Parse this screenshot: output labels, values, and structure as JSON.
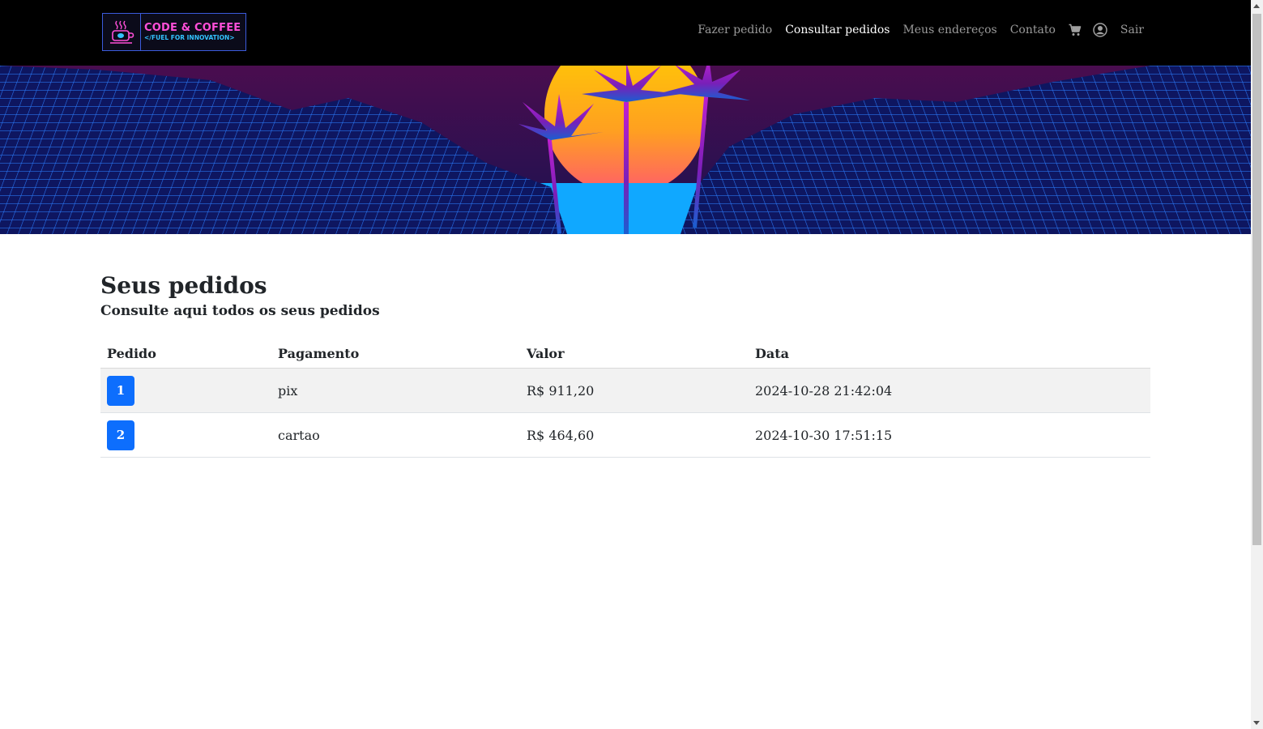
{
  "brand": {
    "title": "CODE & COFFEE",
    "subtitle": "</FUEL FOR INNOVATION>"
  },
  "nav": {
    "items": [
      {
        "label": "Fazer pedido",
        "active": false
      },
      {
        "label": "Consultar pedidos",
        "active": true
      },
      {
        "label": "Meus endereços",
        "active": false
      },
      {
        "label": "Contato",
        "active": false
      }
    ],
    "cart_icon": "cart-icon",
    "account_icon": "user-circle-icon",
    "logout_label": "Sair"
  },
  "colors": {
    "accent": "#0d6efd",
    "navbar_bg": "#000000",
    "banner_sun": "#ffb000",
    "banner_grid": "#1e6bff"
  },
  "main": {
    "title": "Seus pedidos",
    "subtitle": "Consulte aqui todos os seus pedidos",
    "table": {
      "headers": [
        "Pedido",
        "Pagamento",
        "Valor",
        "Data"
      ],
      "rows": [
        {
          "pedido": "1",
          "pagamento": "pix",
          "valor": "R$ 911,20",
          "data": "2024-10-28 21:42:04"
        },
        {
          "pedido": "2",
          "pagamento": "cartao",
          "valor": "R$ 464,60",
          "data": "2024-10-30 17:51:15"
        }
      ]
    }
  }
}
